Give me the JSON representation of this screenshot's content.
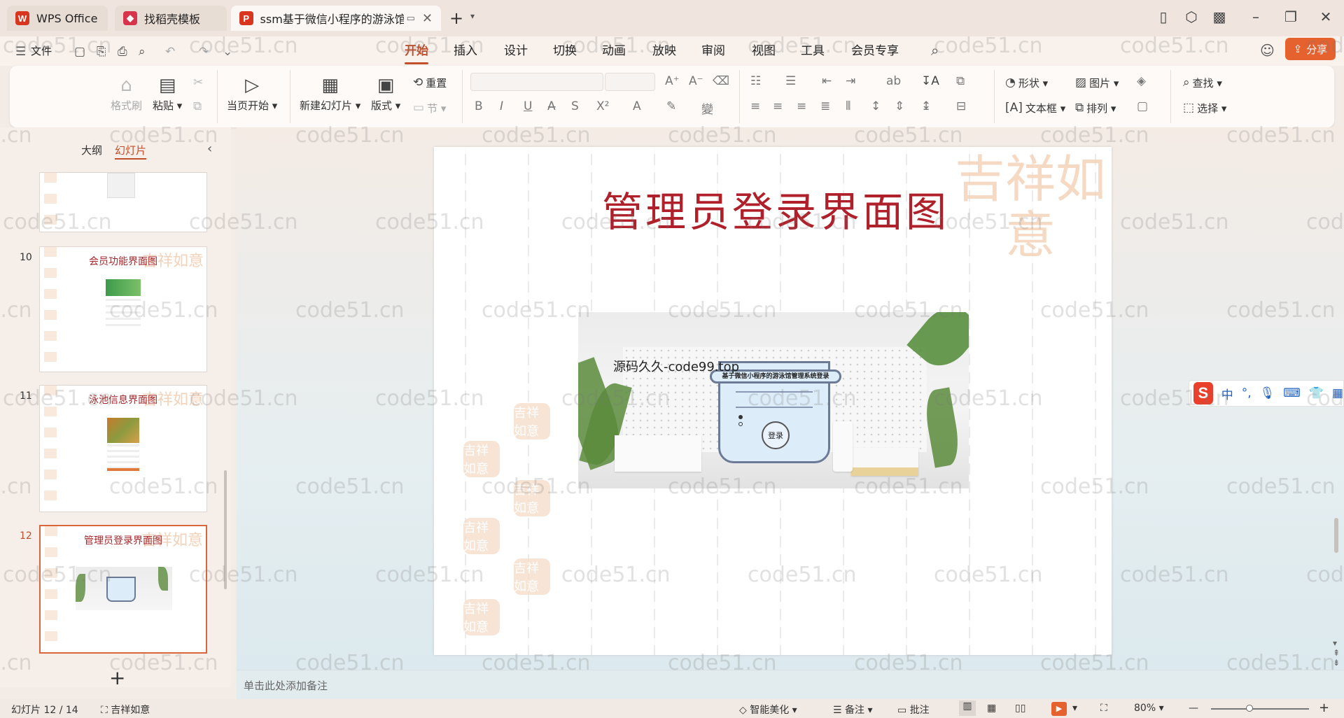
{
  "tabs": [
    {
      "label": "WPS Office",
      "logo": "W",
      "color": "#d9361f"
    },
    {
      "label": "找稻壳模板",
      "logo": "◆",
      "color": "#d7334b"
    },
    {
      "label": "ssm基于微信小程序的游泳馆管",
      "logo": "P",
      "color": "#d9361f"
    }
  ],
  "file_menu": "文件",
  "menu": [
    "开始",
    "插入",
    "设计",
    "切换",
    "动画",
    "放映",
    "审阅",
    "视图",
    "工具",
    "会员专享"
  ],
  "share_label": "分享",
  "ribbon": {
    "format_painter": "格式刷",
    "paste": "粘贴",
    "play_from_current": "当页开始",
    "new_slide": "新建幻灯片",
    "layout": "版式",
    "reset": "重置",
    "section": "节",
    "shape": "形状",
    "picture": "图片",
    "textbox": "文本框",
    "arrange": "排列",
    "find": "查找",
    "select": "选择"
  },
  "panel": {
    "tab_outline": "大纲",
    "tab_slides": "幻灯片",
    "thumbs": [
      {
        "num": "10",
        "title": "会员功能界面图"
      },
      {
        "num": "11",
        "title": "泳池信息界面图"
      },
      {
        "num": "12",
        "title": "管理员登录界面图"
      }
    ]
  },
  "slide": {
    "title": "管理员登录界面图",
    "deco": "吉祥如意",
    "caption": "源码久久-code99.top",
    "phone_header": "基于微信小程序的游泳馆管理系统登录",
    "login_button": "登录"
  },
  "notes_placeholder": "单击此处添加备注",
  "status": {
    "slide_counter": "幻灯片 12 / 14",
    "theme": "吉祥如意",
    "beautify": "智能美化",
    "notes": "备注",
    "comments": "批注",
    "zoom": "80%"
  },
  "ime": {
    "lang": "中",
    "punct": "°,"
  },
  "watermark": "code51.cn"
}
